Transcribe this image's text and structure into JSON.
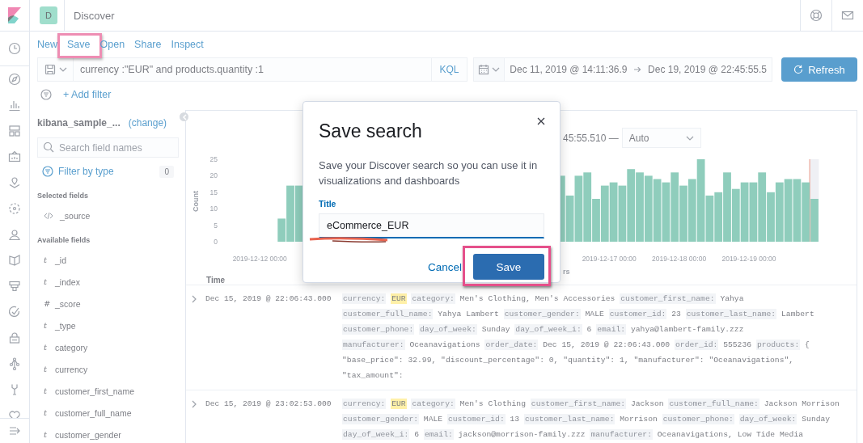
{
  "header": {
    "space_initial": "D",
    "title": "Discover"
  },
  "top_nav": [
    {
      "label": "New",
      "highlighted": false
    },
    {
      "label": "Save",
      "highlighted": true
    },
    {
      "label": "Open",
      "highlighted": false
    },
    {
      "label": "Share",
      "highlighted": false
    },
    {
      "label": "Inspect",
      "highlighted": false
    }
  ],
  "query_bar": {
    "query": "currency :\"EUR\" and products.quantity :1",
    "language": "KQL",
    "start": "Dec 11, 2019 @ 14:11:36.9",
    "end": "Dec 19, 2019 @ 22:45:55.5",
    "refresh": "Refresh"
  },
  "filter_bar": {
    "add_filter": "+ Add filter"
  },
  "sidebar": {
    "index_pattern": "kibana_sample_...",
    "change_link": "(change)",
    "search": {
      "placeholder": "Search field names"
    },
    "filter_by_type": "Filter by type",
    "filter_count": "0",
    "selected_heading": "Selected fields",
    "selected_fields": [
      {
        "kind": "source",
        "name": "_source"
      }
    ],
    "available_heading": "Available fields",
    "available_fields": [
      {
        "kind": "glyph",
        "glyph": "t",
        "name": "_id"
      },
      {
        "kind": "glyph",
        "glyph": "t",
        "name": "_index"
      },
      {
        "kind": "glyph",
        "glyph": "#",
        "name": "_score"
      },
      {
        "kind": "glyph",
        "glyph": "t",
        "name": "_type"
      },
      {
        "kind": "glyph",
        "glyph": "t",
        "name": "category"
      },
      {
        "kind": "glyph",
        "glyph": "t",
        "name": "currency"
      },
      {
        "kind": "glyph",
        "glyph": "t",
        "name": "customer_first_name"
      },
      {
        "kind": "glyph",
        "glyph": "t",
        "name": "customer_full_name"
      },
      {
        "kind": "glyph",
        "glyph": "t",
        "name": "customer_gender"
      }
    ]
  },
  "histogram": {
    "range_text": "45:55.510 —",
    "interval": "Auto",
    "chart_data": {
      "type": "bar",
      "ylabel": "Count",
      "xlabel": "rs",
      "ylim": [
        0,
        25
      ],
      "yticks": [
        0,
        5,
        10,
        15,
        20,
        25
      ],
      "categories": [
        null,
        null,
        null,
        null,
        "2019-12-12 00:00",
        null,
        null,
        null,
        null,
        null,
        null,
        null,
        null,
        null,
        null,
        null,
        null,
        null,
        null,
        null,
        null,
        null,
        null,
        null,
        null,
        null,
        null,
        null,
        null,
        null,
        null,
        null,
        null,
        null,
        null,
        null,
        null,
        null,
        null,
        null,
        null,
        null,
        null,
        null,
        "2019-12-17 00:00",
        null,
        null,
        null,
        null,
        null,
        null,
        null,
        "2019-12-18 00:00",
        null,
        null,
        null,
        null,
        null,
        null,
        null,
        "2019-12-19 00:00",
        null,
        null,
        null,
        null,
        null,
        null,
        null
      ],
      "values": [
        null,
        null,
        null,
        null,
        null,
        null,
        7,
        17,
        17,
        null,
        null,
        null,
        null,
        null,
        null,
        null,
        null,
        null,
        null,
        null,
        null,
        null,
        null,
        null,
        null,
        null,
        null,
        null,
        null,
        null,
        null,
        null,
        null,
        null,
        null,
        null,
        null,
        null,
        20,
        14,
        20,
        21,
        13,
        17,
        18,
        17,
        22,
        21,
        20,
        19,
        18,
        21,
        17,
        19,
        25,
        14,
        15,
        21,
        16,
        18,
        18,
        21,
        15,
        18,
        19,
        19,
        18,
        13
      ]
    }
  },
  "doc_table": {
    "columns": [
      "Time"
    ],
    "rows": [
      {
        "time": "Dec 15, 2019 @ 22:06:43.000",
        "fields": [
          {
            "key": "currency:",
            "value": "EUR",
            "highlight": true
          },
          {
            "key": "category:",
            "value": "Men's Clothing, Men's Accessories",
            "highlight": false
          },
          {
            "key": "customer_first_name:",
            "value": "Yahya",
            "highlight": false
          },
          {
            "key": "customer_full_name:",
            "value": "Yahya Lambert",
            "highlight": false
          },
          {
            "key": "customer_gender:",
            "value": "MALE",
            "highlight": false
          },
          {
            "key": "customer_id:",
            "value": "23",
            "highlight": false
          },
          {
            "key": "customer_last_name:",
            "value": "Lambert",
            "highlight": false
          },
          {
            "key": "customer_phone:",
            "highlight": false
          },
          {
            "key": "day_of_week:",
            "value": "Sunday",
            "highlight": false
          },
          {
            "key": "day_of_week_i:",
            "value": "6",
            "highlight": false
          },
          {
            "key": "email:",
            "value": "yahya@lambert-family.zzz",
            "highlight": false
          },
          {
            "key": "manufacturer:",
            "value": "Oceanavigations",
            "highlight": false
          },
          {
            "key": "order_date:",
            "value": "Dec 15, 2019 @ 22:06:43.000",
            "highlight": false
          },
          {
            "key": "order_id:",
            "value": "555236",
            "highlight": false
          },
          {
            "key": "products:",
            "value": "{ \"base_price\": 32.99, \"discount_percentage\": 0, \"quantity\": 1, \"manufacturer\": \"Oceanavigations\", \"tax_amount\":",
            "highlight": false
          }
        ]
      },
      {
        "time": "Dec 15, 2019 @ 23:02:53.000",
        "fields": [
          {
            "key": "currency:",
            "value": "EUR",
            "highlight": true
          },
          {
            "key": "category:",
            "value": "Men's Clothing",
            "highlight": false
          },
          {
            "key": "customer_first_name:",
            "value": "Jackson",
            "highlight": false
          },
          {
            "key": "customer_full_name:",
            "value": "Jackson Morrison",
            "highlight": false
          },
          {
            "key": "customer_gender:",
            "value": "MALE",
            "highlight": false
          },
          {
            "key": "customer_id:",
            "value": "13",
            "highlight": false
          },
          {
            "key": "customer_last_name:",
            "value": "Morrison",
            "highlight": false
          },
          {
            "key": "customer_phone:",
            "highlight": false
          },
          {
            "key": "day_of_week:",
            "value": "Sunday",
            "highlight": false
          },
          {
            "key": "day_of_week_i:",
            "value": "6",
            "highlight": false
          },
          {
            "key": "email:",
            "value": "jackson@morrison-family.zzz",
            "highlight": false
          },
          {
            "key": "manufacturer:",
            "value": "Oceanavigations, Low Tide Media",
            "highlight": false
          }
        ]
      }
    ]
  },
  "modal": {
    "title": "Save search",
    "description": "Save your Discover search so you can use it in visualizations and dashboards",
    "field_label": "Title",
    "field_value": "eCommerce_EUR",
    "cancel": "Cancel",
    "save": "Save",
    "save_highlighted": true,
    "value_underlined": true
  }
}
